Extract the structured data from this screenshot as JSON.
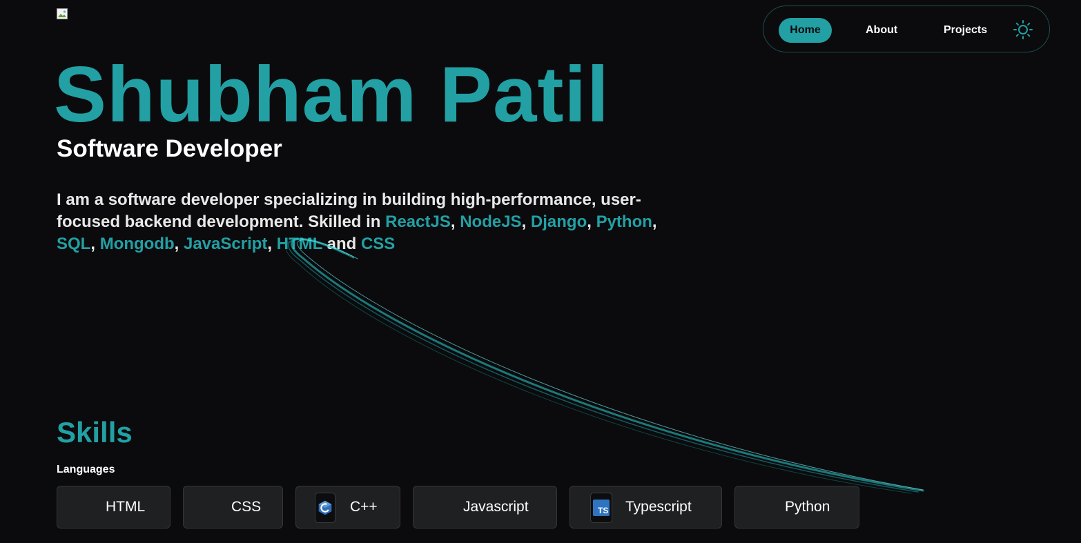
{
  "nav": {
    "home": "Home",
    "about": "About",
    "projects": "Projects",
    "theme_icon": "sun-icon"
  },
  "hero": {
    "name": "Shubham Patil",
    "role": "Software Developer",
    "bio_intro": "I am a software developer specializing in building high-performance, user-focused backend development. Skilled in ",
    "skills_inline": [
      "ReactJS",
      "NodeJS",
      "Django",
      "Python",
      "SQL",
      "Mongodb",
      "JavaScript",
      "HTML",
      "CSS"
    ],
    "sep": ", ",
    "and": " and "
  },
  "skills": {
    "title": "Skills",
    "languages_title": "Languages",
    "languages": [
      {
        "label": "HTML",
        "icon": ""
      },
      {
        "label": "CSS",
        "icon": ""
      },
      {
        "label": "C++",
        "icon": "cpp-icon"
      },
      {
        "label": "Javascript",
        "icon": ""
      },
      {
        "label": "Typescript",
        "icon": "typescript-icon",
        "icon_text": "TS"
      },
      {
        "label": "Python",
        "icon": ""
      }
    ]
  },
  "colors": {
    "accent": "#22a0a4",
    "background": "#0b0b0d",
    "chip_bg": "#1f2022",
    "streak": "#2ad6d8"
  }
}
